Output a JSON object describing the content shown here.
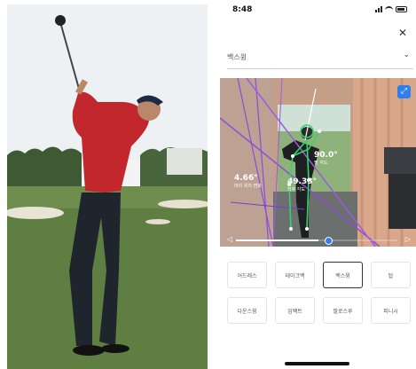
{
  "status": {
    "time": "8:48"
  },
  "header": {
    "close_label": "✕"
  },
  "selector": {
    "value": "백스윙",
    "chevron": "⌄"
  },
  "video": {
    "measurements": [
      {
        "value": "4.66°",
        "caption": "머리 위치 변화"
      },
      {
        "value": "90.0°",
        "caption": "팔 각도"
      },
      {
        "value": "49.33°",
        "caption": "척추 각도"
      }
    ],
    "timeline_progress": 0.57,
    "icons": {
      "tool": "line-tool-icon",
      "play": "play-icon",
      "mirror": "flip-icon"
    }
  },
  "buttons": [
    {
      "label": "어드레스",
      "active": false
    },
    {
      "label": "테이크백",
      "active": false
    },
    {
      "label": "백스윙",
      "active": true
    },
    {
      "label": "탑",
      "active": false
    },
    {
      "label": "다운스윙",
      "active": false
    },
    {
      "label": "임팩트",
      "active": false
    },
    {
      "label": "팔로스루",
      "active": false
    },
    {
      "label": "피니시",
      "active": false
    }
  ]
}
